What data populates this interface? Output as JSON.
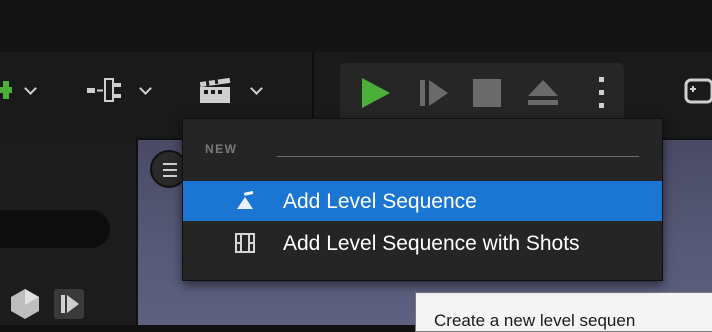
{
  "colors": {
    "accent_selected": "#1a76d2",
    "play_green": "#4caf3a",
    "menu_bg": "#252525",
    "viewport_bg": "#565978"
  },
  "toolbar": {
    "icons": [
      "add-content-icon",
      "blueprint-icon",
      "cinematics-icon",
      "play-icon",
      "advance-frame-icon",
      "stop-icon",
      "eject-icon",
      "more-options-icon",
      "platforms-icon"
    ]
  },
  "dropdown": {
    "section_header": "NEW",
    "items": [
      {
        "label": "Add Level Sequence",
        "icon": "level-sequence-icon",
        "selected": true
      },
      {
        "label": "Add Level Sequence with Shots",
        "icon": "level-sequence-shots-icon",
        "selected": false
      }
    ]
  },
  "tooltip": {
    "text": "Create a new level sequen"
  }
}
